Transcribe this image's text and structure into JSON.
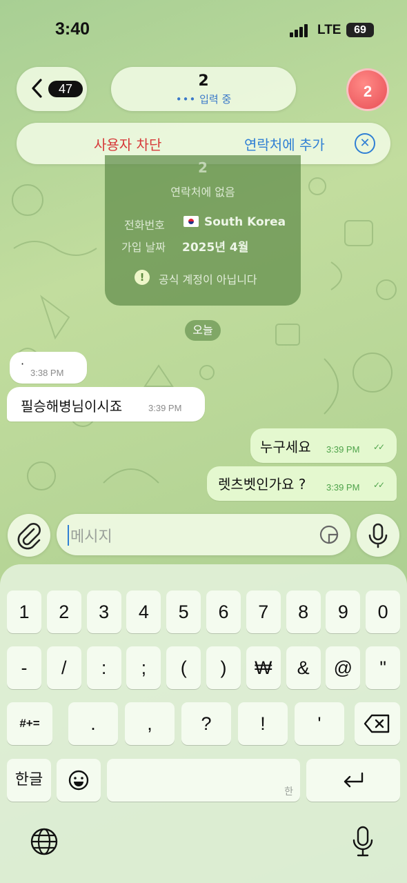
{
  "status_bar": {
    "time": "3:40",
    "network": "LTE",
    "battery": "69"
  },
  "nav": {
    "back_count": "47",
    "chat_title": "2",
    "typing_status": "입력 중",
    "avatar_initial": "2"
  },
  "actions": {
    "block": "사용자 차단",
    "add_contact": "연락처에 추가"
  },
  "info_card": {
    "name": "2",
    "subtitle": "연락처에 없음",
    "phone_label": "전화번호",
    "phone_value": "South Korea",
    "joined_label": "가입 날짜",
    "joined_value": "2025년 4월",
    "warning": "공식 계정이 아닙니다"
  },
  "date_separator": "오늘",
  "messages": [
    {
      "direction": "in",
      "text": "·",
      "time": "3:38 PM"
    },
    {
      "direction": "in",
      "text": "필승해병님이시죠",
      "time": "3:39 PM"
    },
    {
      "direction": "out",
      "text": "누구세요",
      "time": "3:39 PM"
    },
    {
      "direction": "out",
      "text": "렛츠벳인가요 ?",
      "time": "3:39 PM"
    }
  ],
  "composer": {
    "placeholder": "메시지"
  },
  "keyboard": {
    "row1": [
      "1",
      "2",
      "3",
      "4",
      "5",
      "6",
      "7",
      "8",
      "9",
      "0"
    ],
    "row2": [
      "-",
      "/",
      ":",
      ";",
      "(",
      ")",
      "₩",
      "&",
      "@",
      "\""
    ],
    "row3_left": "#+=",
    "row3": [
      ".",
      ",",
      "?",
      "!",
      "'"
    ],
    "lang_key": "한글",
    "space_hint": "한"
  },
  "colors": {
    "accent": "#2f7fd4",
    "danger": "#d63838",
    "outgoing_bubble": "#e4f8cf"
  },
  "icons": [
    "back-chevron-icon",
    "attach-icon",
    "sticker-icon",
    "mic-icon",
    "backspace-icon",
    "emoji-icon",
    "return-icon",
    "globe-icon",
    "close-icon",
    "warning-icon"
  ]
}
